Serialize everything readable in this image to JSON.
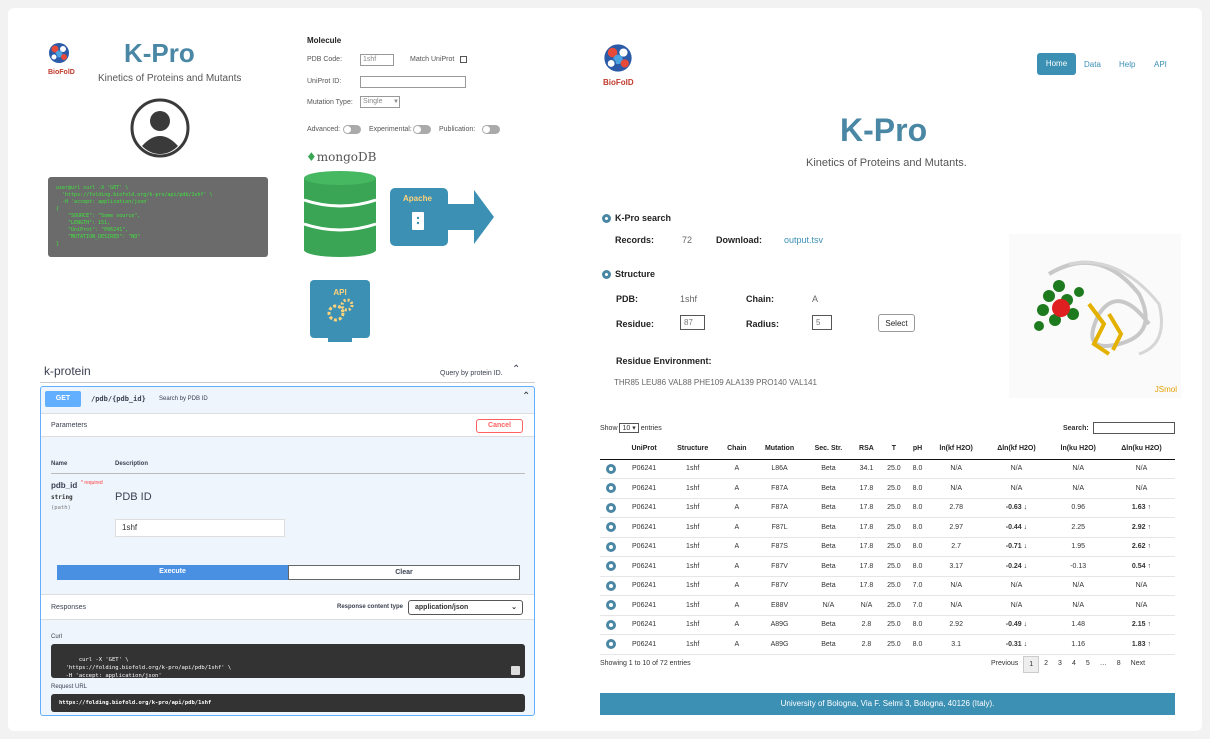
{
  "left": {
    "logo_text": "BioFolD",
    "title": "K-Pro",
    "subtitle": "Kinetics of Proteins and Mutants",
    "form": {
      "heading": "Molecule",
      "pdb_label": "PDB Code:",
      "pdb_value": "1shf",
      "match_label": "Match UniProt",
      "uniprot_label": "UniProt ID:",
      "mutation_label": "Mutation Type:",
      "mutation_value": "Single",
      "advanced": "Advanced:",
      "experimental": "Experimental:",
      "publication": "Publication:"
    },
    "code_snippet": "user@url curl -X 'GET' \\\n  'https://folding.biofold.org/k-pro/api/pdb/1shf' \\\n  -H 'accept: application/json'\n{\n    \"SOURCE\": \"Some source\",\n    \"LENGTH\": 151,\n    \"UniProt\": \"P06241\",\n    \"MUTATION_DESIRED\": \"NO\"\n}",
    "db_label": "mongoDB",
    "apache_label": "Apache",
    "api_label": "API"
  },
  "swagger": {
    "section": "k-protein",
    "section_desc": "Query by protein ID.",
    "method": "GET",
    "path": "/pdb/{pdb_id}",
    "summary": "Search by PDB ID",
    "parameters": "Parameters",
    "cancel": "Cancel",
    "col_name": "Name",
    "col_desc": "Description",
    "param_name": "pdb_id",
    "required": "* required",
    "param_type": "string",
    "param_in": "(path)",
    "param_desc": "PDB ID",
    "param_value": "1shf",
    "execute": "Execute",
    "clear": "Clear",
    "responses": "Responses",
    "content_type_label": "Response content type",
    "content_type": "application/json",
    "curl_label": "Curl",
    "curl": "curl -X 'GET' \\\n  'https://folding.biofold.org/k-pro/api/pdb/1shf' \\\n  -H 'accept: application/json'",
    "request_url_label": "Request URL",
    "request_url": "https://folding.biofold.org/k-pro/api/pdb/1shf"
  },
  "right": {
    "logo_text": "BioFolD",
    "nav": [
      "Home",
      "Data",
      "Help",
      "API"
    ],
    "title": "K-Pro",
    "subtitle": "Kinetics of Proteins and Mutants.",
    "search": {
      "heading": "K-Pro search",
      "records_label": "Records:",
      "records": "72",
      "download_label": "Download:",
      "download": "output.tsv"
    },
    "structure": {
      "heading": "Structure",
      "pdb_label": "PDB:",
      "pdb": "1shf",
      "chain_label": "Chain:",
      "chain": "A",
      "residue_label": "Residue:",
      "residue": "87",
      "radius_label": "Radius:",
      "radius": "5",
      "select": "Select",
      "env_label": "Residue Environment:",
      "env": "THR85 LEU86 VAL88 PHE109 ALA139 PRO140 VAL141",
      "viewer_brand": "JSmol"
    },
    "table": {
      "show": "Show",
      "entries_value": "10",
      "entries": "entries",
      "search_label": "Search:",
      "headers": [
        "",
        "UniProt",
        "Structure",
        "Chain",
        "Mutation",
        "Sec. Str.",
        "RSA",
        "T",
        "pH",
        "ln(kf H2O)",
        "Δln(kf H2O)",
        "ln(ku H2O)",
        "Δln(ku H2O)"
      ],
      "rows": [
        [
          "P06241",
          "1shf",
          "A",
          "L86A",
          "Beta",
          "34.1",
          "25.0",
          "8.0",
          "N/A",
          "N/A",
          "N/A",
          "N/A"
        ],
        [
          "P06241",
          "1shf",
          "A",
          "F87A",
          "Beta",
          "17.8",
          "25.0",
          "8.0",
          "N/A",
          "N/A",
          "N/A",
          "N/A"
        ],
        [
          "P06241",
          "1shf",
          "A",
          "F87A",
          "Beta",
          "17.8",
          "25.0",
          "8.0",
          "2.78",
          "-0.63 ↓",
          "0.96",
          "1.63 ↑"
        ],
        [
          "P06241",
          "1shf",
          "A",
          "F87L",
          "Beta",
          "17.8",
          "25.0",
          "8.0",
          "2.97",
          "-0.44 ↓",
          "2.25",
          "2.92 ↑"
        ],
        [
          "P06241",
          "1shf",
          "A",
          "F87S",
          "Beta",
          "17.8",
          "25.0",
          "8.0",
          "2.7",
          "-0.71 ↓",
          "1.95",
          "2.62 ↑"
        ],
        [
          "P06241",
          "1shf",
          "A",
          "F87V",
          "Beta",
          "17.8",
          "25.0",
          "8.0",
          "3.17",
          "-0.24 ↓",
          "-0.13",
          "0.54 ↑"
        ],
        [
          "P06241",
          "1shf",
          "A",
          "F87V",
          "Beta",
          "17.8",
          "25.0",
          "7.0",
          "N/A",
          "N/A",
          "N/A",
          "N/A"
        ],
        [
          "P06241",
          "1shf",
          "A",
          "E88V",
          "N/A",
          "N/A",
          "25.0",
          "7.0",
          "N/A",
          "N/A",
          "N/A",
          "N/A"
        ],
        [
          "P06241",
          "1shf",
          "A",
          "A89G",
          "Beta",
          "2.8",
          "25.0",
          "8.0",
          "2.92",
          "-0.49 ↓",
          "1.48",
          "2.15 ↑"
        ],
        [
          "P06241",
          "1shf",
          "A",
          "A89G",
          "Beta",
          "2.8",
          "25.0",
          "8.0",
          "3.1",
          "-0.31 ↓",
          "1.16",
          "1.83 ↑"
        ]
      ],
      "info": "Showing 1 to 10 of 72 entries",
      "pager": [
        "Previous",
        "1",
        "2",
        "3",
        "4",
        "5",
        "…",
        "8",
        "Next"
      ]
    },
    "footer": "University of Bologna, Via F. Selmi 3, Bologna, 40126 (Italy)."
  },
  "colors": {
    "accent": "#3b90b4",
    "title": "#4a87a5",
    "neg": "#e03030",
    "mongo": "#3aa655"
  }
}
